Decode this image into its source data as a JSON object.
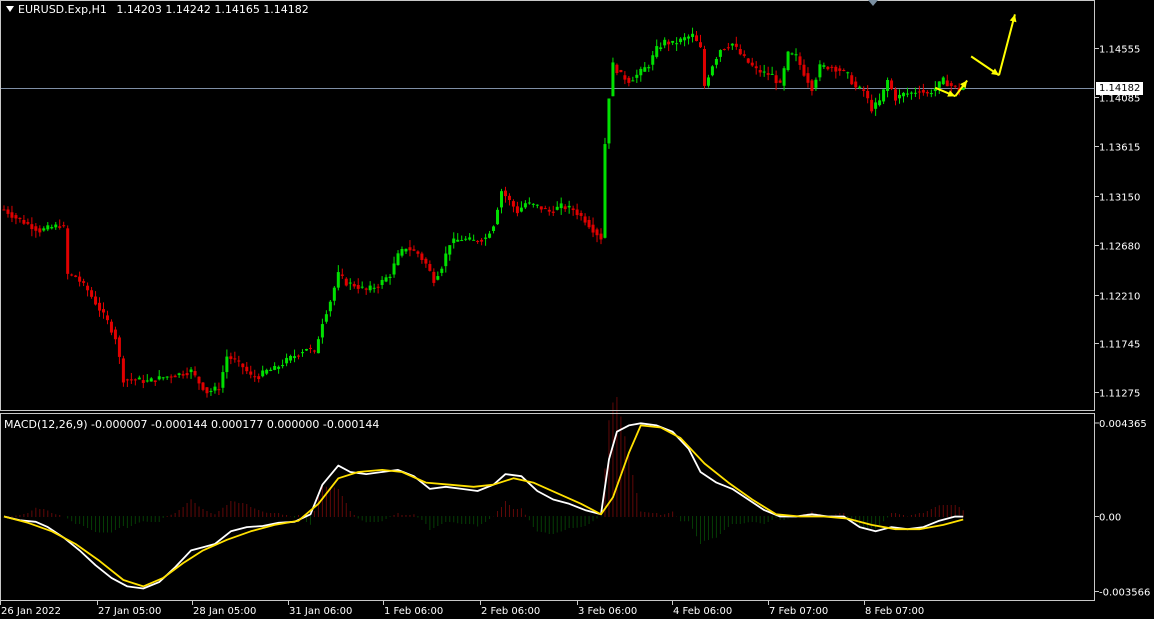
{
  "header": {
    "symbol": "EURUSD.Exp,H1",
    "ohlc": "1.14203 1.14242 1.14165 1.14182"
  },
  "price_axis": [
    "1.14555",
    "1.14085",
    "1.13615",
    "1.13150",
    "1.12680",
    "1.12210",
    "1.11745",
    "1.11275"
  ],
  "current_price": "1.14182",
  "macd": {
    "label": "MACD(12,26,9) -0.000007 -0.000144 0.000177 0.000000 -0.000144",
    "axis": [
      "0.004365",
      "0.00",
      "-0.003566"
    ]
  },
  "time_axis": [
    "26 Jan 2022",
    "27 Jan 05:00",
    "28 Jan 05:00",
    "31 Jan 06:00",
    "1 Feb 06:00",
    "2 Feb 06:00",
    "3 Feb 06:00",
    "4 Feb 06:00",
    "7 Feb 07:00",
    "8 Feb 07:00"
  ],
  "colors": {
    "bull": "#00e000",
    "bear": "#e00000",
    "macd_line": "#ffffff",
    "signal_line": "#ffe000",
    "hist_pos": "#c01010",
    "hist_neg": "#0a7a0a",
    "arrows": "#ffff00"
  },
  "chart_data": {
    "type": "line",
    "ylim": [
      1.1105,
      1.1505
    ],
    "price_path": [
      [
        0,
        1.1302
      ],
      [
        3,
        1.1294
      ],
      [
        6,
        1.1288
      ],
      [
        9,
        1.1282
      ],
      [
        12,
        1.1285
      ],
      [
        14,
        1.1287
      ],
      [
        15,
        1.1284
      ],
      [
        16,
        1.124
      ],
      [
        18,
        1.1238
      ],
      [
        21,
        1.1225
      ],
      [
        23,
        1.1213
      ],
      [
        26,
        1.1195
      ],
      [
        28,
        1.118
      ],
      [
        29,
        1.116
      ],
      [
        30,
        1.114
      ],
      [
        33,
        1.114
      ],
      [
        36,
        1.1138
      ],
      [
        40,
        1.1142
      ],
      [
        44,
        1.1145
      ],
      [
        47,
        1.1148
      ],
      [
        49,
        1.1137
      ],
      [
        51,
        1.1128
      ],
      [
        54,
        1.1132
      ],
      [
        56,
        1.1162
      ],
      [
        58,
        1.1158
      ],
      [
        60,
        1.1152
      ],
      [
        62,
        1.1143
      ],
      [
        64,
        1.1143
      ],
      [
        66,
        1.1148
      ],
      [
        68,
        1.115
      ],
      [
        71,
        1.1158
      ],
      [
        74,
        1.1165
      ],
      [
        76,
        1.117
      ],
      [
        78,
        1.1165
      ],
      [
        80,
        1.1195
      ],
      [
        82,
        1.1215
      ],
      [
        84,
        1.124
      ],
      [
        86,
        1.1232
      ],
      [
        88,
        1.123
      ],
      [
        91,
        1.1225
      ],
      [
        94,
        1.123
      ],
      [
        97,
        1.124
      ],
      [
        99,
        1.1258
      ],
      [
        101,
        1.1266
      ],
      [
        104,
        1.126
      ],
      [
        106,
        1.125
      ],
      [
        108,
        1.1235
      ],
      [
        110,
        1.1248
      ],
      [
        112,
        1.127
      ],
      [
        115,
        1.1274
      ],
      [
        118,
        1.1272
      ],
      [
        121,
        1.1275
      ],
      [
        123,
        1.1288
      ],
      [
        125,
        1.132
      ],
      [
        127,
        1.131
      ],
      [
        129,
        1.13
      ],
      [
        131,
        1.1308
      ],
      [
        134,
        1.1305
      ],
      [
        137,
        1.13
      ],
      [
        140,
        1.1305
      ],
      [
        143,
        1.1302
      ],
      [
        146,
        1.1292
      ],
      [
        148,
        1.1283
      ],
      [
        150,
        1.1275
      ],
      [
        151,
        1.1365
      ],
      [
        152,
        1.141
      ],
      [
        153,
        1.144
      ],
      [
        155,
        1.143
      ],
      [
        157,
        1.1425
      ],
      [
        159,
        1.143
      ],
      [
        162,
        1.144
      ],
      [
        164,
        1.1455
      ],
      [
        166,
        1.1462
      ],
      [
        168,
        1.146
      ],
      [
        171,
        1.1465
      ],
      [
        173,
        1.1468
      ],
      [
        175,
        1.1455
      ],
      [
        176,
        1.142
      ],
      [
        178,
        1.144
      ],
      [
        180,
        1.1455
      ],
      [
        183,
        1.146
      ],
      [
        185,
        1.145
      ],
      [
        187,
        1.1442
      ],
      [
        189,
        1.1435
      ],
      [
        191,
        1.1432
      ],
      [
        193,
        1.143
      ],
      [
        195,
        1.142
      ],
      [
        197,
        1.145
      ],
      [
        199,
        1.1448
      ],
      [
        201,
        1.1432
      ],
      [
        203,
        1.1418
      ],
      [
        205,
        1.1438
      ],
      [
        208,
        1.1438
      ],
      [
        210,
        1.1435
      ],
      [
        212,
        1.143
      ],
      [
        214,
        1.1418
      ],
      [
        216,
        1.1415
      ],
      [
        218,
        1.1398
      ],
      [
        220,
        1.1405
      ],
      [
        222,
        1.1425
      ],
      [
        224,
        1.1408
      ],
      [
        226,
        1.1412
      ],
      [
        228,
        1.1413
      ],
      [
        230,
        1.1416
      ],
      [
        232,
        1.1412
      ],
      [
        234,
        1.1418
      ],
      [
        236,
        1.1425
      ],
      [
        238,
        1.142
      ],
      [
        240,
        1.1416
      ],
      [
        241,
        1.1418
      ]
    ],
    "macd_series": [
      [
        0,
        0.0
      ],
      [
        4,
        -0.00018
      ],
      [
        8,
        -0.00025
      ],
      [
        11,
        -0.0005
      ],
      [
        15,
        -0.001
      ],
      [
        19,
        -0.0016
      ],
      [
        23,
        -0.0023
      ],
      [
        27,
        -0.0029
      ],
      [
        31,
        -0.0033
      ],
      [
        35,
        -0.0034
      ],
      [
        39,
        -0.0031
      ],
      [
        43,
        -0.0024
      ],
      [
        47,
        -0.0016
      ],
      [
        50,
        -0.00145
      ],
      [
        53,
        -0.0013
      ],
      [
        57,
        -0.0007
      ],
      [
        61,
        -0.0005
      ],
      [
        65,
        -0.00045
      ],
      [
        69,
        -0.0003
      ],
      [
        73,
        -0.00025
      ],
      [
        77,
        0.0001
      ],
      [
        80,
        0.0015
      ],
      [
        84,
        0.0024
      ],
      [
        87,
        0.0021
      ],
      [
        91,
        0.002
      ],
      [
        95,
        0.0021
      ],
      [
        99,
        0.0022
      ],
      [
        103,
        0.0019
      ],
      [
        107,
        0.0013
      ],
      [
        111,
        0.0014
      ],
      [
        115,
        0.0013
      ],
      [
        119,
        0.0012
      ],
      [
        123,
        0.0015
      ],
      [
        126,
        0.002
      ],
      [
        130,
        0.0019
      ],
      [
        134,
        0.0012
      ],
      [
        138,
        0.0008
      ],
      [
        142,
        0.0006
      ],
      [
        146,
        0.0003
      ],
      [
        150,
        0.0001
      ],
      [
        152,
        0.0027
      ],
      [
        154,
        0.004
      ],
      [
        157,
        0.0043
      ],
      [
        160,
        0.0044
      ],
      [
        164,
        0.0043
      ],
      [
        168,
        0.004
      ],
      [
        172,
        0.0032
      ],
      [
        175,
        0.0021
      ],
      [
        179,
        0.0016
      ],
      [
        183,
        0.0013
      ],
      [
        187,
        0.0008
      ],
      [
        191,
        0.0003
      ],
      [
        195,
        0.0
      ],
      [
        199,
        0.0
      ],
      [
        203,
        0.0001
      ],
      [
        207,
        0.0
      ],
      [
        211,
        0.0
      ],
      [
        215,
        -0.0005
      ],
      [
        219,
        -0.0007
      ],
      [
        223,
        -0.0005
      ],
      [
        227,
        -0.0006
      ],
      [
        231,
        -0.0005
      ],
      [
        235,
        -0.0002
      ],
      [
        239,
        0.0
      ],
      [
        241,
        -7e-06
      ]
    ],
    "signal_series": [
      [
        0,
        0.0
      ],
      [
        6,
        -0.0003
      ],
      [
        12,
        -0.0007
      ],
      [
        18,
        -0.0013
      ],
      [
        24,
        -0.0021
      ],
      [
        30,
        -0.003
      ],
      [
        35,
        -0.0033
      ],
      [
        40,
        -0.0029
      ],
      [
        45,
        -0.0022
      ],
      [
        50,
        -0.0016
      ],
      [
        56,
        -0.0011
      ],
      [
        62,
        -0.0007
      ],
      [
        68,
        -0.0004
      ],
      [
        74,
        -0.0002
      ],
      [
        79,
        0.0006
      ],
      [
        84,
        0.0018
      ],
      [
        89,
        0.0021
      ],
      [
        95,
        0.0022
      ],
      [
        100,
        0.0021
      ],
      [
        106,
        0.0016
      ],
      [
        112,
        0.0015
      ],
      [
        118,
        0.0014
      ],
      [
        123,
        0.0015
      ],
      [
        128,
        0.0018
      ],
      [
        133,
        0.0016
      ],
      [
        139,
        0.0011
      ],
      [
        145,
        0.0006
      ],
      [
        150,
        0.0001
      ],
      [
        153,
        0.0009
      ],
      [
        157,
        0.003
      ],
      [
        160,
        0.0043
      ],
      [
        165,
        0.0042
      ],
      [
        170,
        0.0037
      ],
      [
        176,
        0.0025
      ],
      [
        182,
        0.0016
      ],
      [
        188,
        0.0008
      ],
      [
        194,
        0.0001
      ],
      [
        200,
        0.0
      ],
      [
        206,
        0.0
      ],
      [
        212,
        -0.0001
      ],
      [
        218,
        -0.0004
      ],
      [
        224,
        -0.0006
      ],
      [
        230,
        -0.0006
      ],
      [
        236,
        -0.0004
      ],
      [
        241,
        -0.000144
      ]
    ],
    "histogram_ylim": [
      -0.003566,
      0.004365
    ],
    "forecast_arrows": [
      [
        [
          234,
          1.1418
        ],
        [
          239,
          1.141
        ]
      ],
      [
        [
          239,
          1.141
        ],
        [
          242,
          1.1425
        ]
      ],
      [
        [
          243,
          1.1448
        ],
        [
          250,
          1.143
        ]
      ],
      [
        [
          250,
          1.143
        ],
        [
          254,
          1.1488
        ]
      ]
    ]
  }
}
